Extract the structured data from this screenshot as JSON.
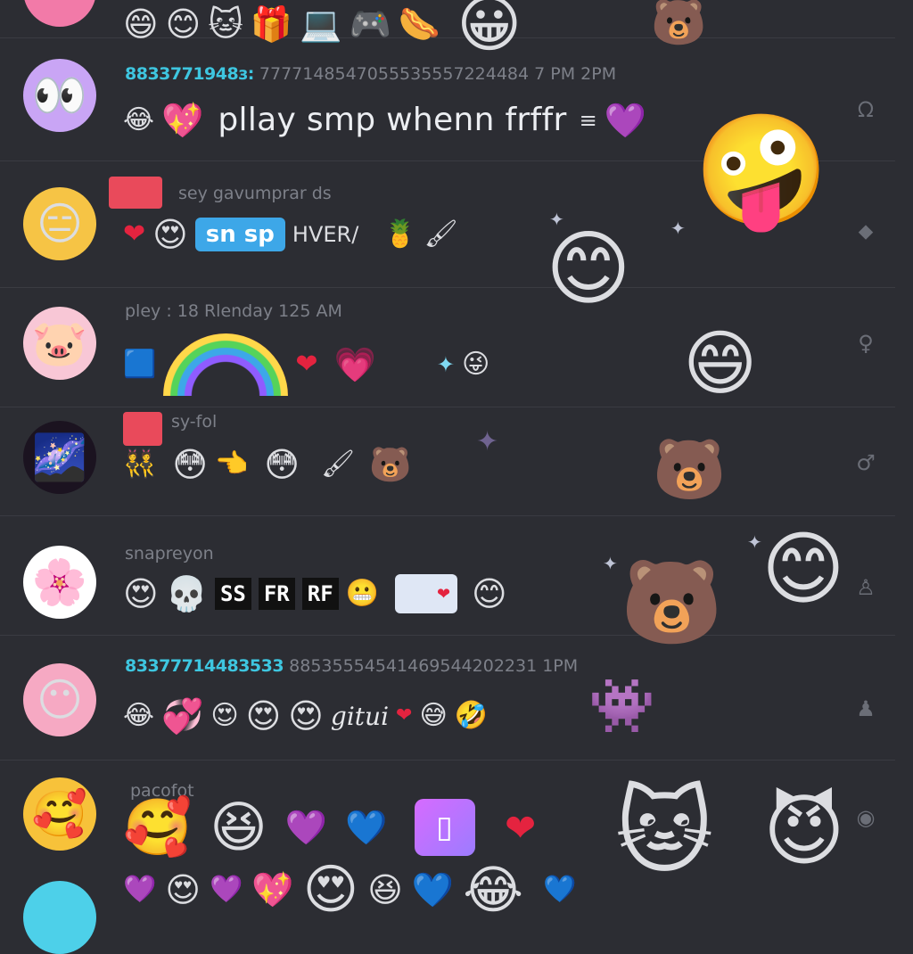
{
  "messages": [
    {
      "id": "m0",
      "username": "",
      "meta": "",
      "line": [
        "😄",
        "😊",
        "🐱",
        "🎁",
        "💻",
        "🎮",
        "🌭",
        "😀"
      ]
    },
    {
      "id": "m1",
      "avatar": "👀",
      "username": "8833771948з:",
      "meta": "7777148547055535557224484 7 PM   2PM",
      "emoji_before": [
        "😂",
        "💖"
      ],
      "text": "pllay smp whenn frffr",
      "emoji_after": [
        "≡",
        "💜"
      ]
    },
    {
      "id": "m2",
      "avatar": "😑",
      "meta": "sey gavumprar ds",
      "emoji_before": [
        "❤",
        "😍"
      ],
      "pill": "sn sp",
      "word": "HVER/",
      "emoji_after": [
        "🍍",
        "🖌"
      ]
    },
    {
      "id": "m3",
      "avatar": "🐷",
      "meta": "pley : 18 Rlenday  125 AM",
      "emoji_before": [
        "🟦"
      ],
      "emoji_after": [
        "❤",
        "💗",
        "✦",
        "😜"
      ]
    },
    {
      "id": "m4",
      "avatar": "🌌",
      "meta": "sy-fol",
      "line": [
        "👯",
        "😳",
        "👈",
        "😳",
        "🖌",
        "🐻"
      ]
    },
    {
      "id": "m5",
      "avatar": "🌸",
      "meta": "snapreyon",
      "emoji_before": [
        "😍",
        "💀"
      ],
      "tags": [
        "SS",
        "FR",
        "RF"
      ],
      "emoji_after": [
        "😬",
        "😊"
      ]
    },
    {
      "id": "m6",
      "avatar": "😶",
      "username": "83377714483533",
      "meta": "88535554541469544202231 1PM",
      "emoji_before": [
        "😂",
        "💞",
        "😍",
        "😍",
        "😍"
      ],
      "word": "gitui",
      "emoji_after": [
        "❤",
        "😅",
        "🤣"
      ]
    },
    {
      "id": "m7",
      "avatar": "🥰",
      "meta": "pacofot",
      "line1": [
        "🥰",
        "😆",
        "💜",
        "💙"
      ],
      "app_glyph": "▯",
      "line2": [
        "💜",
        "😍",
        "💜",
        "💖",
        "😍",
        "😆",
        "💙",
        "😂",
        "💙"
      ]
    }
  ],
  "floats": {
    "crazy_face": "🤪",
    "blush_face": "😊",
    "grin_face": "😄",
    "bear_face": "🐻",
    "smile_face": "😊",
    "cat_face": "🐱",
    "ghost_face": "😈",
    "fox_face": "🦊",
    "pixel_pink": "👾",
    "heart_red": "❤"
  },
  "side_icons": [
    "ᘯ",
    "⬥",
    "♀",
    "♂",
    "♙",
    "♟",
    "◉"
  ],
  "colors": {
    "background": "#2c2d33",
    "divider": "#3a3b42",
    "username": "#3ec6e0",
    "timestamp": "#7d8089",
    "accent_pill": "#3da7e8"
  }
}
